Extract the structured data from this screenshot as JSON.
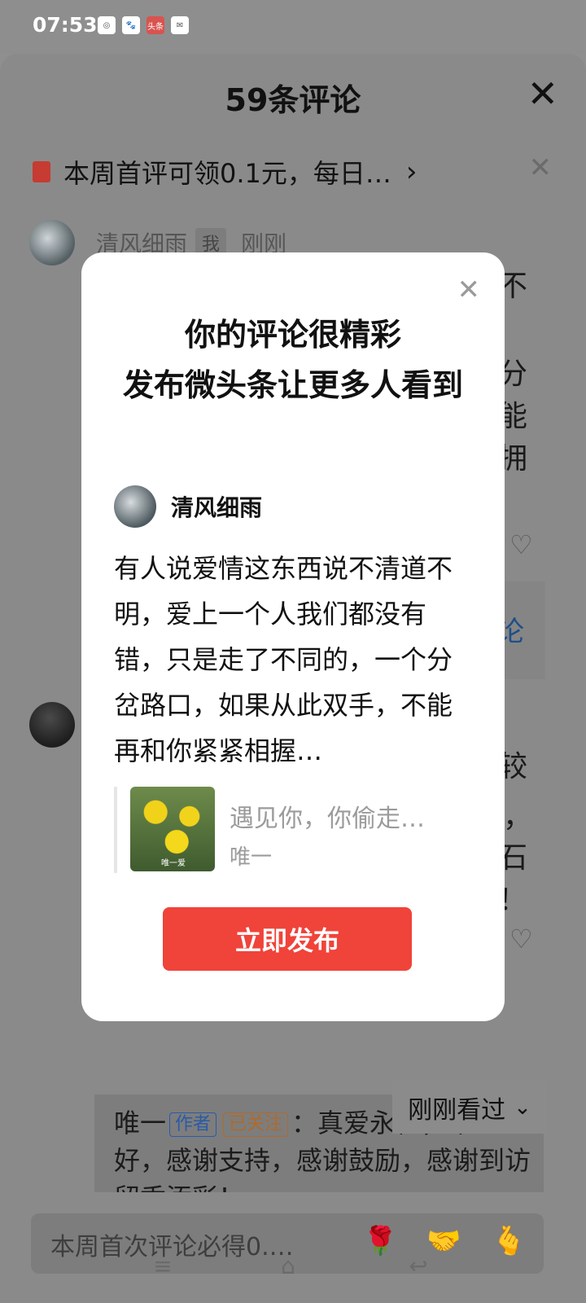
{
  "status_bar": {
    "time": "07:53",
    "icons": [
      "app-icon-1",
      "paw-icon",
      "toutiao-icon",
      "message-icon"
    ],
    "icon_labels": [
      "",
      "",
      "头条",
      ""
    ]
  },
  "sheet": {
    "title": "59条评论",
    "promo": {
      "text": "本周首评可领0.1元，每日…",
      "chevron": "›"
    },
    "first_comment": {
      "name": "清风细雨",
      "tag": "我",
      "time": "刚刚"
    },
    "side_fragments": [
      "不",
      "分",
      "能",
      "拥",
      "较",
      "，",
      "石",
      "！"
    ],
    "side_blue": "论",
    "reply": {
      "user": "唯一",
      "author_tag": "作者",
      "follow_tag": "已关注",
      "text": "：真爱永恒，早上好，感谢支持，感谢鼓励，感谢到访留香添彩！"
    },
    "recent_chip": "刚刚看过",
    "input_placeholder": "本周首次评论必得0.…",
    "emojis": [
      "🌹",
      "🤝",
      "🫰"
    ]
  },
  "modal": {
    "title_line1": "你的评论很精彩",
    "title_line2": "发布微头条让更多人看到",
    "user_name": "清风细雨",
    "comment": "有人说爱情这东西说不清道不明，爱上一个人我们都没有错，只是走了不同的，一个分岔路口，如果从此双手，不能再和你紧紧相握…",
    "quote_title": "遇见你，你偷走…",
    "quote_author": "唯一",
    "quote_thumb_caption": "唯一爱",
    "publish_label": "立即发布"
  },
  "colors": {
    "primary_red": "#f0433a",
    "overlay_gray": "#8f8f8f"
  }
}
